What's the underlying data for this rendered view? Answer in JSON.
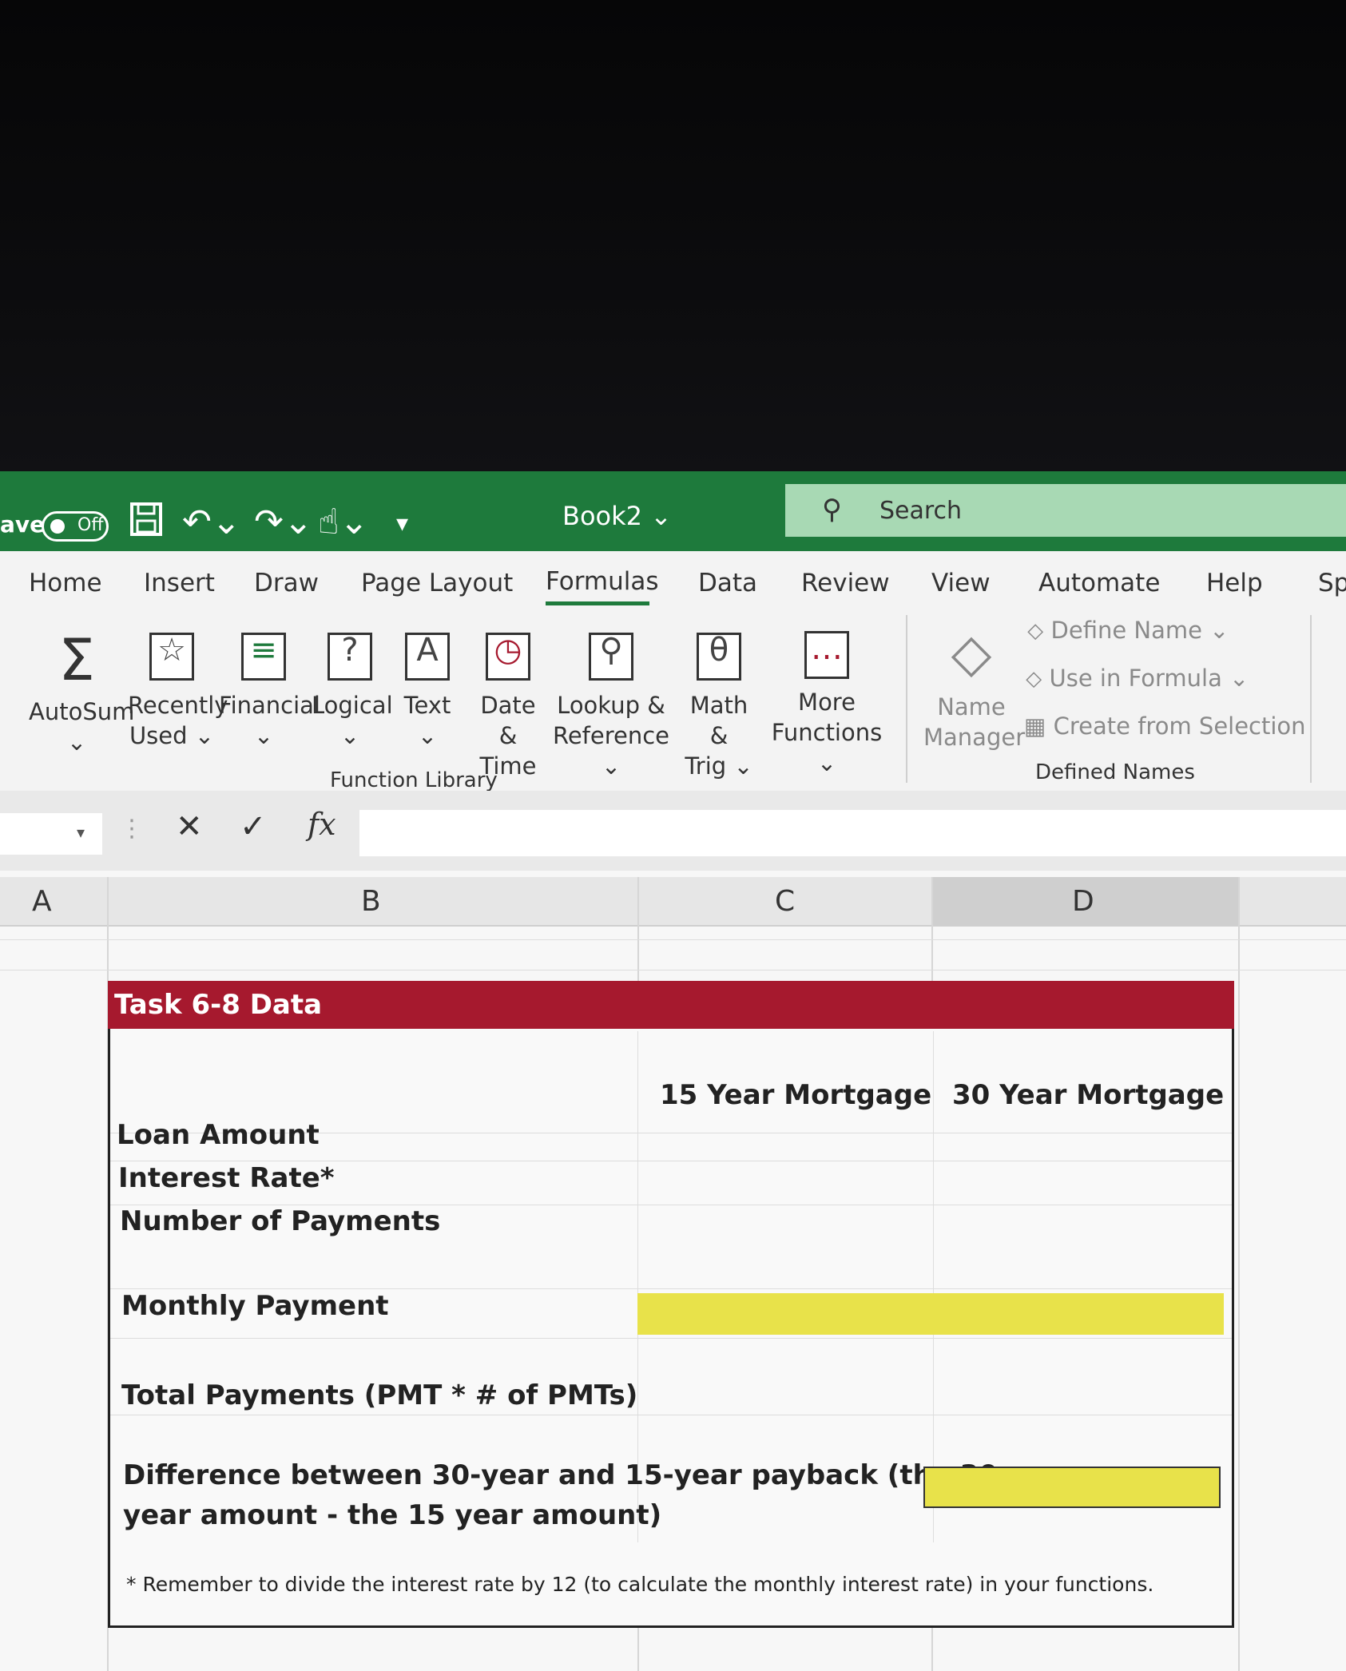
{
  "titlebar": {
    "autosave_label": "ave",
    "autosave_state": "Off",
    "book_title": "Book2 ⌄",
    "search_placeholder": "Search"
  },
  "tabs": [
    "Home",
    "Insert",
    "Draw",
    "Page Layout",
    "Formulas",
    "Data",
    "Review",
    "View",
    "Automate",
    "Help",
    "Sp"
  ],
  "active_tab": "Formulas",
  "function_library": {
    "group_label": "Function Library",
    "buttons": [
      {
        "line1": "AutoSum",
        "line2": "⌄",
        "icon": "sigma-icon"
      },
      {
        "line1": "Recently",
        "line2": "Used ⌄",
        "icon": "star-book-icon"
      },
      {
        "line1": "Financial",
        "line2": "⌄",
        "icon": "database-book-icon"
      },
      {
        "line1": "Logical",
        "line2": "⌄",
        "icon": "question-book-icon"
      },
      {
        "line1": "Text",
        "line2": "⌄",
        "icon": "letter-a-book-icon"
      },
      {
        "line1": "Date &",
        "line2": "Time ⌄",
        "icon": "clock-book-icon"
      },
      {
        "line1": "Lookup &",
        "line2": "Reference ⌄",
        "icon": "magnifier-book-icon"
      },
      {
        "line1": "Math &",
        "line2": "Trig ⌄",
        "icon": "theta-book-icon"
      },
      {
        "line1": "More",
        "line2": "Functions ⌄",
        "icon": "more-dots-book-icon"
      }
    ]
  },
  "defined_names": {
    "group_label": "Defined Names",
    "name_manager_line1": "Name",
    "name_manager_line2": "Manager",
    "define_name": "Define Name ⌄",
    "use_in_formula": "Use in Formula ⌄",
    "create_from_selection": "Create from Selection"
  },
  "formula_bar": {
    "fx": "fx"
  },
  "columns": [
    "A",
    "B",
    "C",
    "D"
  ],
  "task": {
    "title": "Task 6-8 Data",
    "col_15": "15 Year Mortgage",
    "col_30": "30 Year Mortgage",
    "rows": [
      "Loan Amount",
      "Interest Rate*",
      "Number of Payments"
    ],
    "monthly_payment": "Monthly Payment",
    "total_payments": "Total Payments (PMT * # of PMTs)",
    "difference_line1": "Difference between 30-year and 15-year payback (the 30",
    "difference_line2": "year amount  - the 15 year amount)",
    "footnote": "* Remember to divide the interest rate by 12 (to calculate the monthly interest rate) in your functions."
  },
  "colors": {
    "title_bar": "#1e7a3c",
    "task_header": "#a6192e",
    "highlight": "#e8e24a"
  }
}
